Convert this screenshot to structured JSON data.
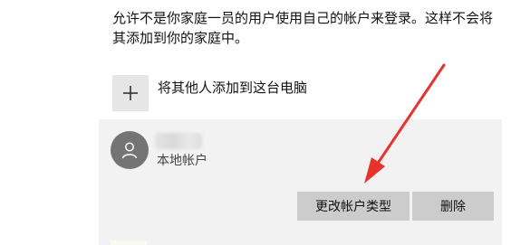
{
  "description": "允许不是你家庭一员的用户使用自己的帐户来登录。这样不会将其添加到你的家庭中。",
  "add_other": {
    "label": "将其他人添加到这台电脑",
    "icon": "plus-icon"
  },
  "account": {
    "avatar_icon": "person-icon",
    "type": "本地帐户"
  },
  "buttons": {
    "change_type": "更改帐户类型",
    "delete": "删除"
  },
  "colors": {
    "arrow": "#e8332d",
    "panel": "#f2f2f2",
    "button": "#cccccc",
    "avatar": "#747474"
  }
}
